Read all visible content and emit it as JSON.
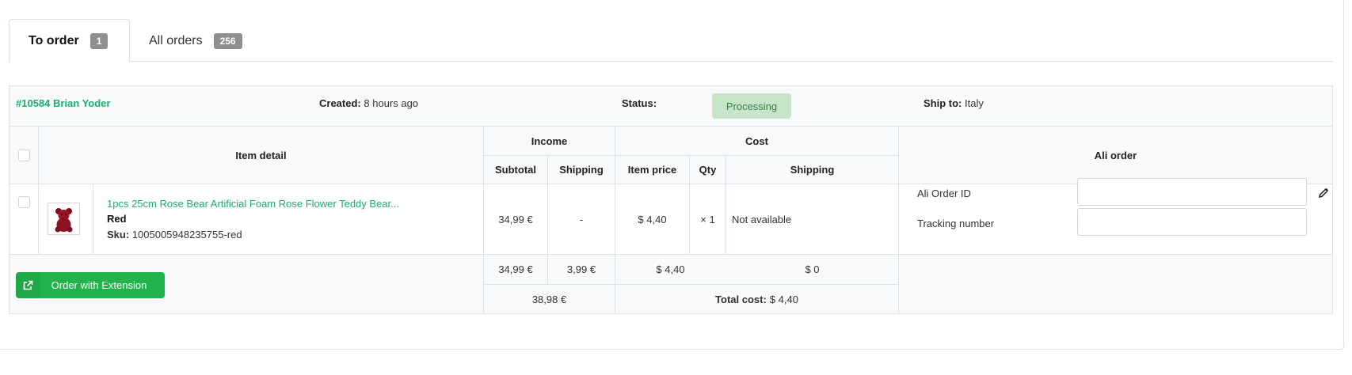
{
  "tabs": [
    {
      "label": "To order",
      "count": "1"
    },
    {
      "label": "All orders",
      "count": "256"
    }
  ],
  "order": {
    "id_name": "#10584 Brian Yoder",
    "created_label": "Created:",
    "created_value": "8 hours ago",
    "status_label": "Status:",
    "status_value": "Processing",
    "ship_label": "Ship to:",
    "ship_value": "Italy"
  },
  "table": {
    "headers": {
      "item_detail": "Item detail",
      "income": "Income",
      "cost": "Cost",
      "ali_order": "Ali order",
      "subtotal": "Subtotal",
      "shipping": "Shipping",
      "item_price": "Item price",
      "qty": "Qty",
      "cost_shipping": "Shipping"
    },
    "item": {
      "title": "1pcs 25cm Rose Bear Artificial Foam Rose Flower Teddy Bear...",
      "variant": "Red",
      "sku_label": "Sku:",
      "sku_value": "1005005948235755-red",
      "subtotal": "34,99 €",
      "shipping": "-",
      "item_price": "$ 4,40",
      "qty": "× 1",
      "cost_shipping": "Not available",
      "ali_order_id_label": "Ali Order ID",
      "tracking_label": "Tracking number"
    },
    "totals": {
      "subtotal": "34,99 €",
      "shipping": "3,99 €",
      "item_price": "$ 4,40",
      "cost_shipping": "$ 0",
      "income_total": "38,98 €",
      "total_cost_label": "Total cost:",
      "total_cost_value": "$ 4,40"
    }
  },
  "actions": {
    "order_extension": "Order with Extension"
  },
  "colors": {
    "accent": "#1aaf6c",
    "button": "#22b24c",
    "status_bg": "#c7e6c9",
    "badge": "#8f8f8f"
  },
  "icons": {
    "external_link": "external-link-icon",
    "edit": "pencil-icon",
    "product": "product-thumbnail"
  }
}
